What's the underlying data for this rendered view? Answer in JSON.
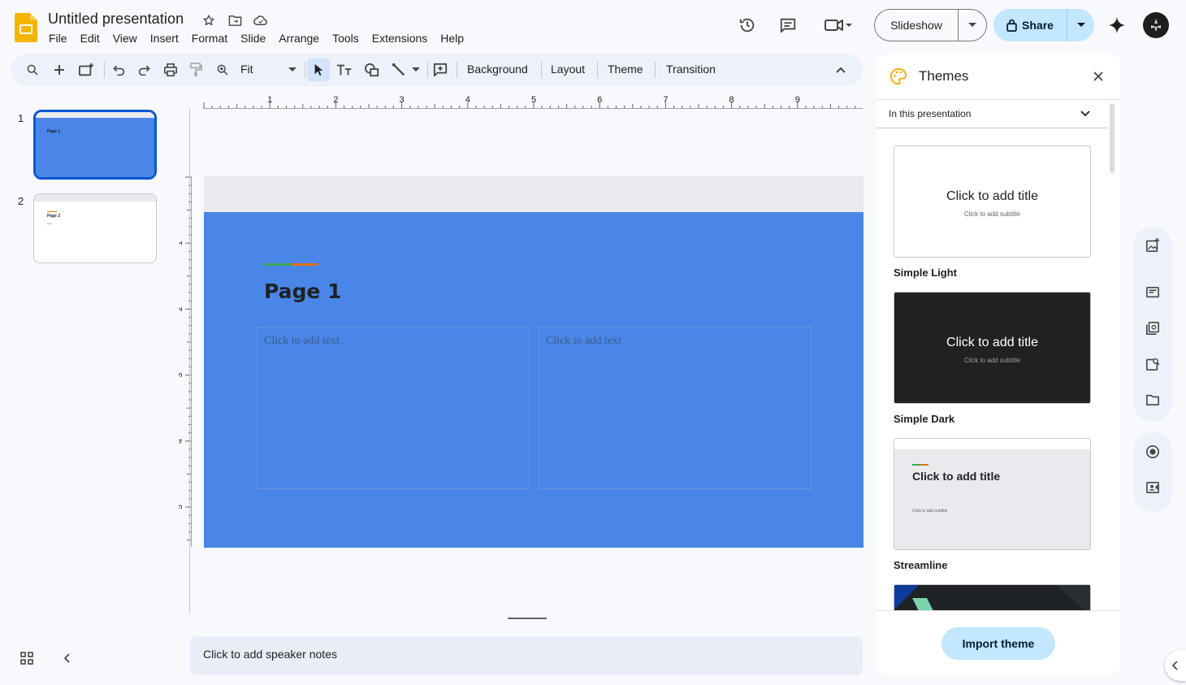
{
  "app": {
    "title": "Untitled presentation",
    "menu": [
      "File",
      "Edit",
      "View",
      "Insert",
      "Format",
      "Slide",
      "Arrange",
      "Tools",
      "Extensions",
      "Help"
    ]
  },
  "header": {
    "slideshow_label": "Slideshow",
    "share_label": "Share"
  },
  "toolbar": {
    "zoom_label": "Fit",
    "background_label": "Background",
    "layout_label": "Layout",
    "theme_label": "Theme",
    "transition_label": "Transition"
  },
  "slides": [
    {
      "number": "1",
      "title": "Page 1",
      "background": "#4a86e8"
    },
    {
      "number": "2",
      "title": "Page 2",
      "background": "#ffffff"
    }
  ],
  "ruler": {
    "horizontal_labels": [
      "1",
      "2",
      "3",
      "4",
      "5",
      "6",
      "7",
      "8",
      "9"
    ],
    "vertical_labels": [
      "1",
      "2",
      "3",
      "4",
      "5"
    ]
  },
  "slide": {
    "title": "Page 1",
    "left_placeholder": "Click to add text",
    "right_placeholder": "Click to add text"
  },
  "notes": {
    "placeholder": "Click to add speaker notes"
  },
  "themes_panel": {
    "title": "Themes",
    "filter": "In this presentation",
    "themes": [
      {
        "name": "Simple Light",
        "title": "Click to add title",
        "subtitle": "Click to add subtitle"
      },
      {
        "name": "Simple Dark",
        "title": "Click to add title",
        "subtitle": "Click to add subtitle"
      },
      {
        "name": "Streamline",
        "title": "Click to add title",
        "subtitle": "Click to add subtitle"
      }
    ],
    "import_label": "Import theme"
  },
  "colors": {
    "accent_blue": "#0b57d0",
    "share_bg": "#c2e7ff",
    "slide_bg": "#4a86e8"
  }
}
